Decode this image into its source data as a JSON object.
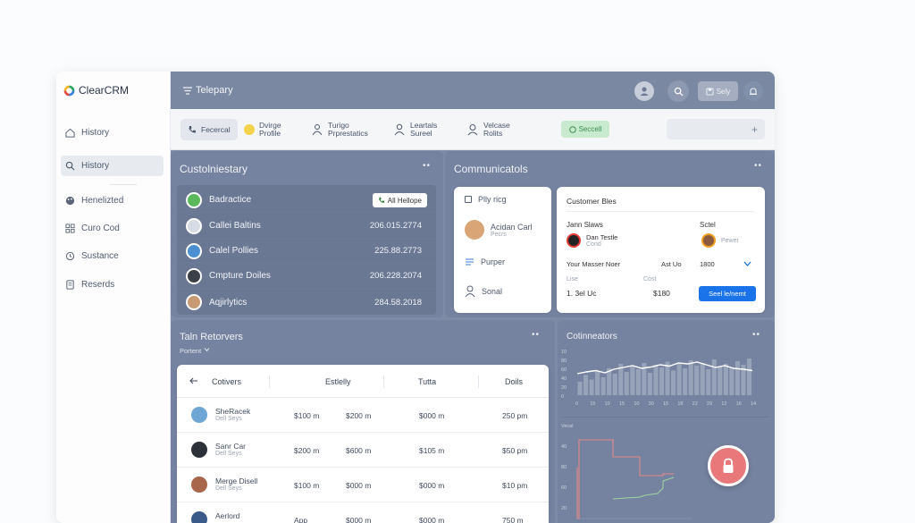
{
  "brand": "ClearCRM",
  "sidebar": {
    "items": [
      {
        "label": "History",
        "icon": "home-icon"
      },
      {
        "label": "History",
        "icon": "search-icon",
        "active": true
      },
      {
        "label": "Henelizted",
        "icon": "palette-icon"
      },
      {
        "label": "Curo Cod",
        "icon": "grid-icon"
      },
      {
        "label": "Sustance",
        "icon": "refresh-icon"
      },
      {
        "label": "Reserds",
        "icon": "document-icon"
      }
    ]
  },
  "topbar": {
    "title": "Telepary",
    "save_label": "Sely"
  },
  "toolbar": {
    "items": [
      {
        "label": "Fecercal",
        "icon": "phone-icon"
      },
      {
        "label": "Dvirge Profile",
        "icon": "badge-icon"
      },
      {
        "label": "Turigo Prprestatics",
        "icon": "people-icon"
      },
      {
        "label": "Leartals Sureel",
        "icon": "person-icon"
      },
      {
        "label": "Velcase Rolits",
        "icon": "person-outline-icon"
      }
    ],
    "status": "Seccell",
    "input_value": "+"
  },
  "customer_panel": {
    "title": "Custolniestary",
    "all_button": "All Hellope",
    "rows": [
      {
        "name": "Badractice",
        "value": ""
      },
      {
        "name": "Callei Baltins",
        "value": "206.015.2774"
      },
      {
        "name": "Calel Pollies",
        "value": "225.88.2773"
      },
      {
        "name": "Cmpture Doiles",
        "value": "206.228.2074"
      },
      {
        "name": "Aqjirlytics",
        "value": "284.58.2018"
      }
    ]
  },
  "comms": {
    "title": "Communicatols",
    "items": [
      {
        "label": "Plly ricg",
        "sub": ""
      },
      {
        "label": "Acidan Carl",
        "sub": "Pecrs"
      },
      {
        "label": "Purper",
        "sub": ""
      },
      {
        "label": "Sonal",
        "sub": ""
      }
    ]
  },
  "customer_card": {
    "title": "Customer Bles",
    "col1": "Jann Slaws",
    "col2": "Sctel",
    "person_name": "Dan Testle",
    "person_sub": "Cond",
    "person2_sub": "Pewer",
    "row_label": "Your Masser Noer",
    "row_val1": "Ast Uo",
    "row_val2": "1800",
    "label_a": "Lise",
    "label_b": "Cost",
    "val_a": "1. 3el Uc",
    "val_b": "$180",
    "button": "Seel le/nemt"
  },
  "retention": {
    "title": "Taln Retorvers",
    "filter": "Portent",
    "headers": [
      "Cotivers",
      "Estlelly",
      "Tutta",
      "Doils"
    ],
    "rows": [
      {
        "name": "SheRacek",
        "sub": "Dell Seys",
        "v1": "$100 m",
        "v2": "$200 m",
        "v3": "$000 m",
        "v4": "250 pm"
      },
      {
        "name": "Sanr Car",
        "sub": "Dell Seys",
        "v1": "$200 m",
        "v2": "$600 m",
        "v3": "$105 m",
        "v4": "$50 pm"
      },
      {
        "name": "Merge Disell",
        "sub": "Dell Seys",
        "v1": "$100 m",
        "v2": "$000 m",
        "v3": "$000 m",
        "v4": "$10 pm"
      },
      {
        "name": "Aerlord",
        "sub": "",
        "v1": "App",
        "v2": "$000 m",
        "v3": "$000 m",
        "v4": "750 m"
      }
    ]
  },
  "analytics": {
    "title": "Cotinneators",
    "xticks": [
      "0",
      "15",
      "10",
      "15",
      "10",
      "30",
      "15",
      "18",
      "22",
      "29",
      "12",
      "16",
      "14"
    ],
    "yticks": [
      "10",
      "80",
      "60",
      "40",
      "20",
      "0"
    ],
    "y2ticks": [
      "Vecal",
      "40",
      "80",
      "60",
      "20"
    ],
    "line": [
      48,
      52,
      55,
      50,
      58,
      62,
      66,
      60,
      63,
      68,
      65,
      72,
      70,
      74,
      68,
      62,
      66,
      60,
      58,
      55
    ],
    "bars": [
      30,
      45,
      35,
      55,
      40,
      60,
      48,
      70,
      52,
      65,
      58,
      72,
      50,
      68,
      62,
      75,
      55,
      70,
      60,
      78,
      66,
      72,
      58,
      80,
      64,
      70,
      62,
      76,
      68,
      82
    ]
  },
  "colors": {
    "main_bg": "#7d8ba6",
    "panel_bg": "#7583a0",
    "accent_blue": "#1a73e8",
    "success_bg": "#c8ebcf",
    "lock_red": "#e9787a"
  }
}
